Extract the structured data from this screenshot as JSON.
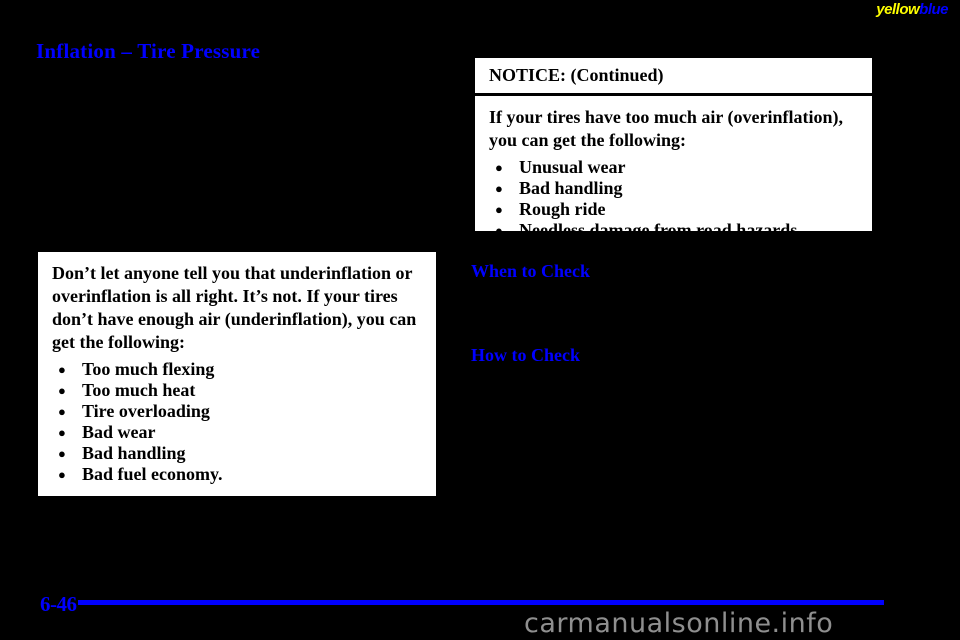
{
  "page": {
    "number": "6-46",
    "background_color": "#000000",
    "accent_color": "#0000FF"
  },
  "watermarks": {
    "top": {
      "part1": "yellow",
      "part2": "blue",
      "color1": "#FFFF00",
      "color2": "#0000FF"
    },
    "bottom": {
      "text": "carmanualsonline.info",
      "color": "#8f8f8f"
    }
  },
  "headings": {
    "main": "Inflation – Tire Pressure",
    "when_to_check": "When to Check",
    "how_to_check": "How to Check"
  },
  "notice_left": {
    "body": "Don’t let anyone tell you that underinflation or overinflation is all right. It’s not. If your tires don’t have enough air (underinflation), you can get the following:",
    "bullets": [
      "Too much flexing",
      "Too much heat",
      "Tire overloading",
      "Bad wear",
      "Bad handling",
      "Bad fuel economy."
    ],
    "continued_label": "NOTICE: (Continued)"
  },
  "notice_right": {
    "header": "NOTICE: (Continued)",
    "body": "If your tires have too much air (overinflation), you can get the following:",
    "bullets": [
      "Unusual wear",
      "Bad handling",
      "Rough ride",
      "Needless damage from road hazards."
    ]
  }
}
